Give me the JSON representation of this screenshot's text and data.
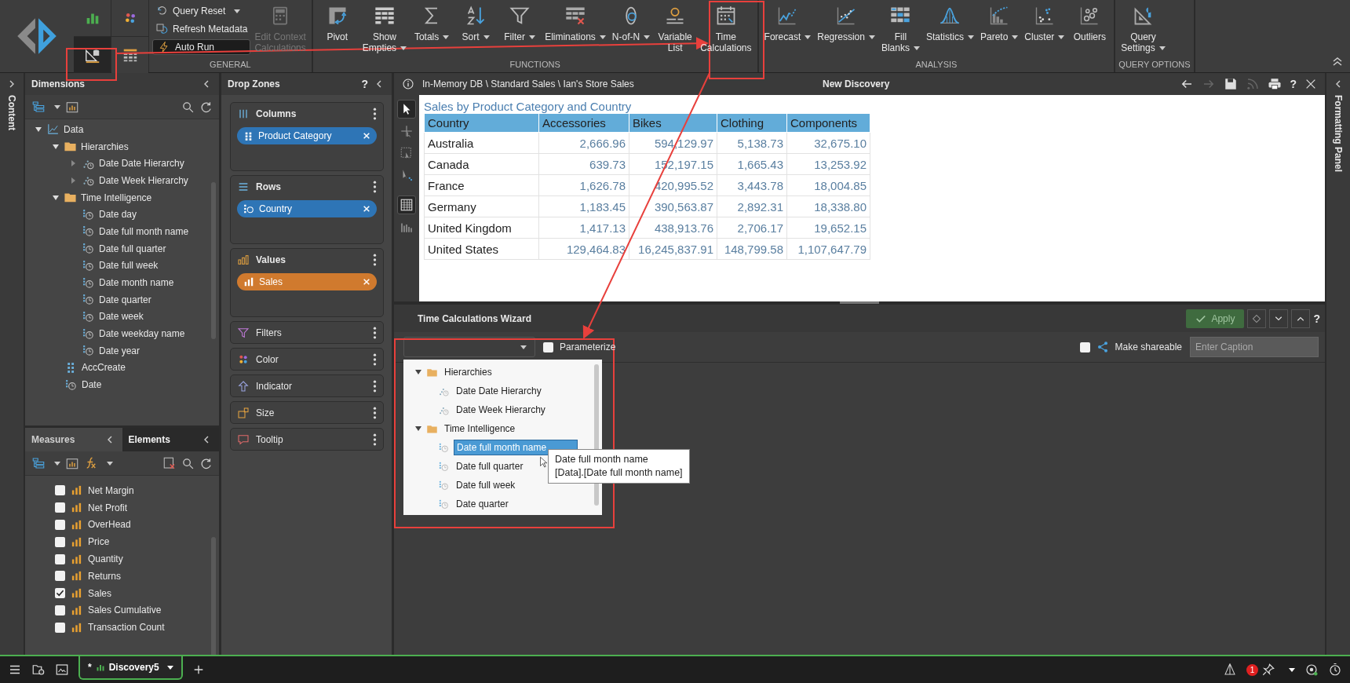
{
  "ribbon": {
    "tiles": [
      {
        "selected": false
      },
      {
        "selected": false
      },
      {
        "selected": true
      },
      {
        "selected": false
      }
    ],
    "groups": [
      {
        "label": "GENERAL",
        "small": [
          {
            "label": "Query Reset",
            "dropdown": true,
            "on": false
          },
          {
            "label": "Refresh Metadata",
            "dropdown": false,
            "on": false
          },
          {
            "label": "Auto Run",
            "dropdown": false,
            "on": true
          }
        ],
        "buttons": [
          {
            "lines": [
              "Edit Context",
              "Calculations"
            ],
            "dropdown": false,
            "disabled": true
          }
        ]
      },
      {
        "label": "FUNCTIONS",
        "buttons": [
          {
            "lines": [
              "Pivot"
            ],
            "dropdown": false,
            "disabled": false
          },
          {
            "lines": [
              "Show",
              "Empties"
            ],
            "dropdown": true,
            "disabled": false
          },
          {
            "lines": [
              "Totals"
            ],
            "dropdown": true,
            "disabled": false
          },
          {
            "lines": [
              "Sort"
            ],
            "dropdown": true,
            "disabled": false
          },
          {
            "lines": [
              "Filter"
            ],
            "dropdown": true,
            "disabled": false
          },
          {
            "lines": [
              "Eliminations"
            ],
            "dropdown": true,
            "disabled": false
          },
          {
            "lines": [
              "N-of-N"
            ],
            "dropdown": true,
            "disabled": false
          },
          {
            "lines": [
              "Variable",
              "List"
            ],
            "dropdown": false,
            "disabled": false
          },
          {
            "lines": [
              "Time",
              "Calculations"
            ],
            "dropdown": false,
            "disabled": false
          }
        ]
      },
      {
        "label": "ANALYSIS",
        "buttons": [
          {
            "lines": [
              "Forecast"
            ],
            "dropdown": true,
            "disabled": false
          },
          {
            "lines": [
              "Regression"
            ],
            "dropdown": true,
            "disabled": false
          },
          {
            "lines": [
              "Fill",
              "Blanks"
            ],
            "dropdown": true,
            "disabled": false
          },
          {
            "lines": [
              "Statistics"
            ],
            "dropdown": true,
            "disabled": false
          },
          {
            "lines": [
              "Pareto"
            ],
            "dropdown": true,
            "disabled": false
          },
          {
            "lines": [
              "Cluster"
            ],
            "dropdown": true,
            "disabled": false
          },
          {
            "lines": [
              "Outliers"
            ],
            "dropdown": false,
            "disabled": false
          }
        ]
      },
      {
        "label": "QUERY OPTIONS",
        "buttons": [
          {
            "lines": [
              "Query",
              "Settings"
            ],
            "dropdown": true,
            "disabled": false
          }
        ]
      }
    ]
  },
  "content_strip": {
    "label": "Content"
  },
  "dimensions": {
    "title": "Dimensions",
    "tree": [
      {
        "label": "Data",
        "kind": "dimension",
        "expanded": true,
        "children": [
          {
            "label": "Hierarchies",
            "kind": "folder",
            "expanded": true,
            "children": [
              {
                "label": "Date Date Hierarchy",
                "kind": "hierarchy",
                "expanded": false
              },
              {
                "label": "Date Week Hierarchy",
                "kind": "hierarchy",
                "expanded": false
              }
            ]
          },
          {
            "label": "Time Intelligence",
            "kind": "folder",
            "expanded": true,
            "children": [
              {
                "label": "Date day",
                "kind": "attribute"
              },
              {
                "label": "Date full month name",
                "kind": "attribute"
              },
              {
                "label": "Date full quarter",
                "kind": "attribute"
              },
              {
                "label": "Date full week",
                "kind": "attribute"
              },
              {
                "label": "Date month name",
                "kind": "attribute"
              },
              {
                "label": "Date quarter",
                "kind": "attribute"
              },
              {
                "label": "Date week",
                "kind": "attribute"
              },
              {
                "label": "Date weekday name",
                "kind": "attribute"
              },
              {
                "label": "Date year",
                "kind": "attribute"
              }
            ]
          },
          {
            "label": "AccCreate",
            "kind": "grid"
          },
          {
            "label": "Date",
            "kind": "attribute"
          }
        ]
      }
    ]
  },
  "measures": {
    "tabs": [
      {
        "label": "Measures",
        "selected": true
      },
      {
        "label": "Elements",
        "selected": false
      }
    ],
    "items": [
      {
        "label": "Net Margin",
        "checked": false
      },
      {
        "label": "Net Profit",
        "checked": false
      },
      {
        "label": "OverHead",
        "checked": false
      },
      {
        "label": "Price",
        "checked": false
      },
      {
        "label": "Quantity",
        "checked": false
      },
      {
        "label": "Returns",
        "checked": false
      },
      {
        "label": "Sales",
        "checked": true
      },
      {
        "label": "Sales Cumulative",
        "checked": false
      },
      {
        "label": "Transaction Count",
        "checked": false
      }
    ]
  },
  "drop_zones": {
    "title": "Drop Zones",
    "help": "?",
    "zones": [
      {
        "label": "Columns",
        "kind": "columns",
        "chips": [
          {
            "label": "Product Category",
            "color": "#2e75b6"
          }
        ]
      },
      {
        "label": "Rows",
        "kind": "rows",
        "chips": [
          {
            "label": "Country",
            "color": "#2e75b6"
          }
        ]
      },
      {
        "label": "Values",
        "kind": "values",
        "chips": [
          {
            "label": "Sales",
            "color": "#d07a2e"
          }
        ]
      },
      {
        "label": "Filters",
        "kind": "filters"
      },
      {
        "label": "Color",
        "kind": "color"
      },
      {
        "label": "Indicator",
        "kind": "indicator"
      },
      {
        "label": "Size",
        "kind": "size"
      },
      {
        "label": "Tooltip",
        "kind": "tooltip"
      }
    ]
  },
  "discovery": {
    "path": "In-Memory DB \\ Standard Sales \\ Ian's Store Sales",
    "title": "New Discovery",
    "help": "?",
    "actions": [
      {
        "kind": "back",
        "disabled": false
      },
      {
        "kind": "forward",
        "disabled": true
      },
      {
        "kind": "save",
        "disabled": false
      },
      {
        "kind": "feed",
        "disabled": true
      },
      {
        "kind": "print",
        "disabled": false
      }
    ],
    "tools": [
      {
        "kind": "pointer",
        "selected": true
      },
      {
        "kind": "add",
        "selected": false
      },
      {
        "kind": "region",
        "selected": false
      },
      {
        "kind": "drill",
        "selected": false
      },
      {
        "kind": "grid",
        "selected": true
      },
      {
        "kind": "chart",
        "selected": false
      }
    ],
    "table": {
      "title": "Sales by Product Category and Country",
      "columns": [
        "Country",
        "Accessories",
        "Bikes",
        "Clothing",
        "Components"
      ],
      "rows": [
        [
          "Australia",
          "2,666.96",
          "594,129.97",
          "5,138.73",
          "32,675.10"
        ],
        [
          "Canada",
          "639.73",
          "152,197.15",
          "1,665.43",
          "13,253.92"
        ],
        [
          "France",
          "1,626.78",
          "420,995.52",
          "3,443.78",
          "18,004.85"
        ],
        [
          "Germany",
          "1,183.45",
          "390,563.87",
          "2,892.31",
          "18,338.80"
        ],
        [
          "United Kingdom",
          "1,417.13",
          "438,913.76",
          "2,706.17",
          "19,652.15"
        ],
        [
          "United States",
          "129,464.83",
          "16,245,837.91",
          "148,799.58",
          "1,107,647.79"
        ]
      ]
    }
  },
  "wizard": {
    "title": "Time Calculations Wizard",
    "apply": {
      "label": "Apply",
      "disabled": true
    },
    "help": "?",
    "parameterize": {
      "label": "Parameterize",
      "checked": false
    },
    "shareable": {
      "label": "Make shareable",
      "checked": false
    },
    "caption": {
      "placeholder": "Enter Caption"
    },
    "picker": [
      {
        "label": "Hierarchies",
        "kind": "folder",
        "expanded": true,
        "children": [
          {
            "label": "Date Date Hierarchy",
            "kind": "hierarchy",
            "selected": false
          },
          {
            "label": "Date Week Hierarchy",
            "kind": "hierarchy",
            "selected": false
          }
        ]
      },
      {
        "label": "Time Intelligence",
        "kind": "folder",
        "expanded": true,
        "children": [
          {
            "label": "Date full month name",
            "kind": "attribute",
            "selected": true
          },
          {
            "label": "Date full quarter",
            "kind": "attribute",
            "selected": false
          },
          {
            "label": "Date full week",
            "kind": "attribute",
            "selected": false
          },
          {
            "label": "Date quarter",
            "kind": "attribute",
            "selected": false
          }
        ]
      }
    ],
    "tooltip": [
      "Date full month name",
      "[Data].[Date full month name]"
    ]
  },
  "formatting_strip": {
    "label": "Formatting Panel"
  },
  "taskbar": {
    "tab": {
      "modified": "*",
      "label": "Discovery5",
      "selected": true
    },
    "notifications": "1"
  }
}
